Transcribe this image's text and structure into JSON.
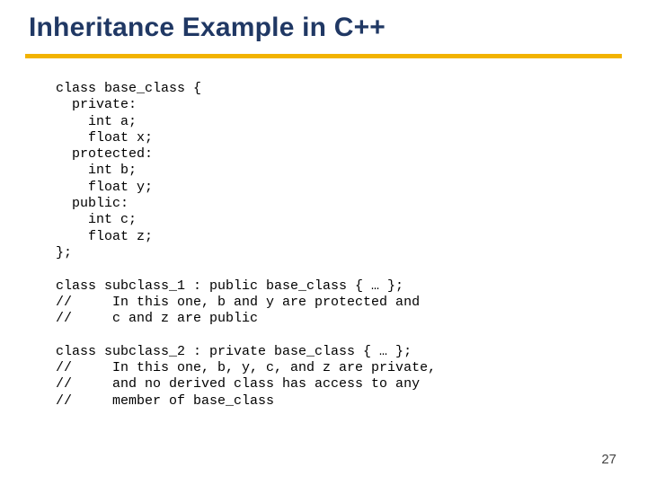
{
  "title": "Inheritance Example in C++",
  "code": "class base_class {\n  private:\n    int a;\n    float x;\n  protected:\n    int b;\n    float y;\n  public:\n    int c;\n    float z;\n};\n\nclass subclass_1 : public base_class { … };\n//     In this one, b and y are protected and\n//     c and z are public\n\nclass subclass_2 : private base_class { … };\n//     In this one, b, y, c, and z are private,\n//     and no derived class has access to any\n//     member of base_class",
  "page_number": "27",
  "colors": {
    "title": "#203864",
    "rule": "#f2b300"
  }
}
